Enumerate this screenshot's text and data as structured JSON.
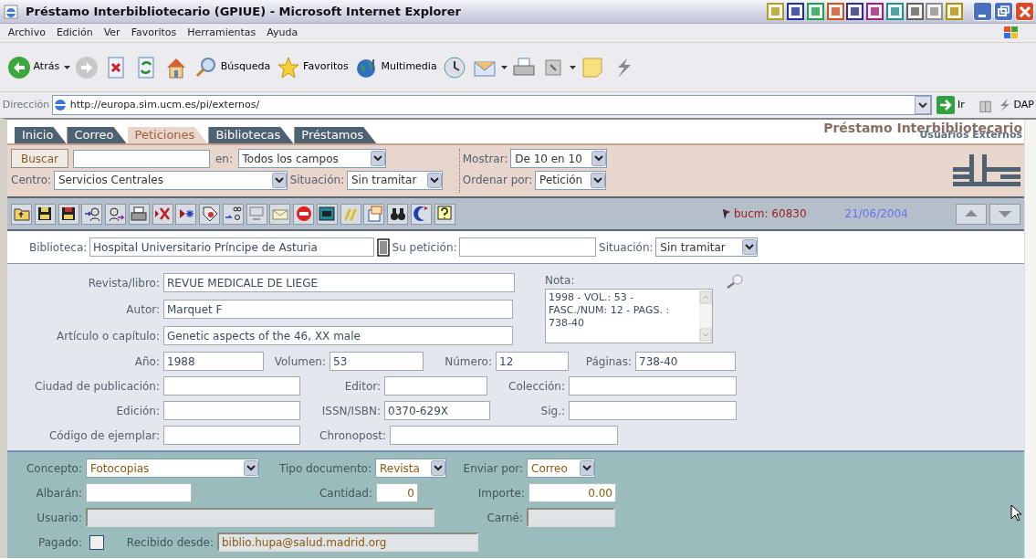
{
  "window": {
    "title": "Préstamo Interbibliotecario (GPIUE) - Microsoft Internet Explorer"
  },
  "menu": [
    "Archivo",
    "Edición",
    "Ver",
    "Favoritos",
    "Herramientas",
    "Ayuda"
  ],
  "toolbar": [
    {
      "label": "Atrás"
    },
    {
      "label": "Búsqueda"
    },
    {
      "label": "Favoritos"
    },
    {
      "label": "Multimedia"
    }
  ],
  "address_bar": {
    "label": "Dirección",
    "url": "http://europa.sim.ucm.es/pi/externos/",
    "go": "Ir",
    "links": "DAP"
  },
  "tabs": [
    {
      "label": "Inicio",
      "selected": false
    },
    {
      "label": "Correo",
      "selected": false
    },
    {
      "label": "Peticiones",
      "selected": true
    },
    {
      "label": "Bibliotecas",
      "selected": false
    },
    {
      "label": "Préstamos",
      "selected": false
    }
  ],
  "header": {
    "title": "Préstamo Interbibliotecario",
    "subtitle": "Usuarios Externos"
  },
  "filters": {
    "button": "Buscar",
    "in": {
      "label": "en:",
      "value": "Todos los campos"
    },
    "show": {
      "label": "Mostrar:",
      "value": "De 10 en 10"
    },
    "centro": {
      "label": "Centro:",
      "value": "Servicios Centrales"
    },
    "situacion": {
      "label": "Situación:",
      "value": "Sin tramitar"
    },
    "order": {
      "label": "Ordenar por:",
      "value": "Petición"
    }
  },
  "record": {
    "ref": "bucm: 60830",
    "date": "21/06/2004"
  },
  "library_row": [
    {
      "label": "Biblioteca:",
      "value": "Hospital Universitario Príncipe de Asturia",
      "kind": "input"
    },
    {
      "label": "Su petición:",
      "kind": "input"
    },
    {
      "label": "Situación:",
      "value": "Sin tramitar",
      "kind": "select"
    }
  ],
  "form": {
    "top_rows": [
      [
        {
          "label": "Revista/libro:",
          "value": "REVUE MEDICALE DE LIEGE"
        }
      ],
      [
        {
          "label": "Autor:",
          "value": "Marquet F"
        }
      ],
      [
        {
          "label": "Artículo o capítulo:",
          "value": "Genetic aspects of the 46, XX male"
        }
      ]
    ],
    "note": {
      "label": "Nota:",
      "value": "1998 - VOL.: 53 - FASC./NUM: 12 - PAGS. : 738-40"
    },
    "rows": [
      [
        {
          "label": "Año:",
          "value": "1988"
        },
        {
          "label": "Volumen:",
          "value": "53"
        },
        {
          "label": "Número:",
          "value": "12"
        },
        {
          "label": "Páginas:",
          "value": "738-40"
        }
      ],
      [
        {
          "label": "Ciudad de publicación:"
        },
        {
          "label": "Editor:"
        },
        {
          "label": "Colección:"
        }
      ],
      [
        {
          "label": "Edición:"
        },
        {
          "label": "ISSN/ISBN:",
          "value": "0370-629X"
        },
        {
          "label": "Sig.:"
        }
      ],
      [
        {
          "label": "Código de ejemplar:"
        },
        {
          "label": "Chronopost:"
        }
      ]
    ]
  },
  "billing": [
    [
      {
        "label": "Concepto:",
        "value": "Fotocopias",
        "kind": "select",
        "disabled": false
      },
      {
        "label": "Tipo documento:",
        "value": "Revista",
        "kind": "select",
        "disabled": false
      },
      {
        "label": "Enviar por:",
        "value": "Correo",
        "kind": "select",
        "disabled": false
      }
    ],
    [
      {
        "label": "Albarán:",
        "kind": "input",
        "disabled": false
      },
      {
        "label": "Cantidad:",
        "value": "0",
        "kind": "number",
        "disabled": false
      },
      {
        "label": "Importe:",
        "value": "0.00",
        "kind": "number",
        "disabled": false
      }
    ],
    [
      {
        "label": "Usuario:",
        "kind": "input",
        "disabled": true
      },
      {
        "label": "Carné:",
        "kind": "input",
        "disabled": true
      }
    ],
    [
      {
        "label": "Pagado:",
        "kind": "checkbox",
        "checked": false,
        "disabled": false
      },
      {
        "label": "Recibido desde:",
        "value": "biblio.hupa@salud.madrid.org",
        "kind": "input",
        "disabled": true
      }
    ]
  ]
}
